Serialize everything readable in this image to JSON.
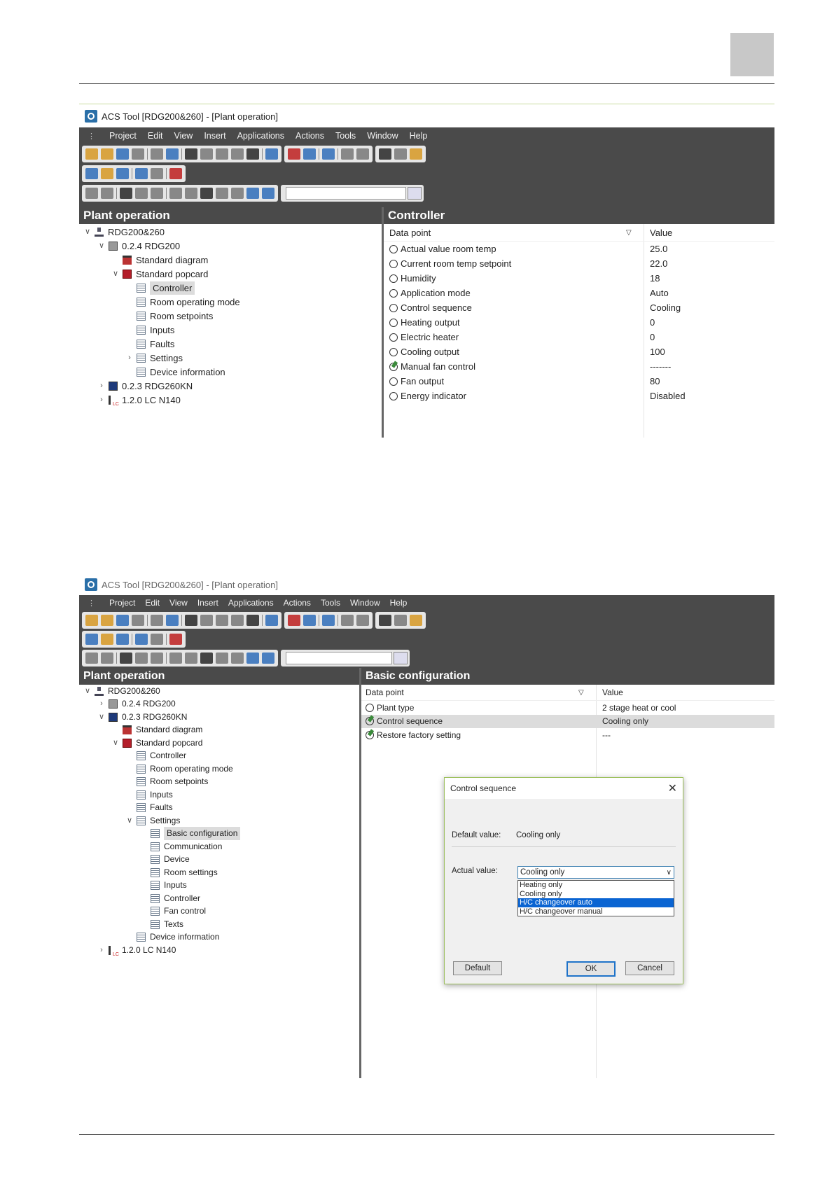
{
  "menu": [
    "Project",
    "Edit",
    "View",
    "Insert",
    "Applications",
    "Actions",
    "Tools",
    "Window",
    "Help"
  ],
  "shot1": {
    "title": "ACS Tool [RDG200&260] - [Plant operation]",
    "left_header": "Plant operation",
    "right_header": "Controller",
    "tree": [
      "RDG200&260",
      "0.2.4 RDG200",
      "Standard diagram",
      "Standard popcard",
      "Controller",
      "Room operating mode",
      "Room setpoints",
      "Inputs",
      "Faults",
      "Settings",
      "Device information",
      "0.2.3  RDG260KN",
      "1.2.0  LC N140"
    ],
    "col_datapoint": "Data point",
    "col_value": "Value",
    "rows": [
      {
        "dp": "Actual value room temp",
        "v": "25.0"
      },
      {
        "dp": "Current room temp setpoint",
        "v": "22.0"
      },
      {
        "dp": "Humidity",
        "v": "18"
      },
      {
        "dp": "Application mode",
        "v": "Auto"
      },
      {
        "dp": "Control sequence",
        "v": "Cooling"
      },
      {
        "dp": "Heating output",
        "v": "0"
      },
      {
        "dp": "Electric heater",
        "v": "0"
      },
      {
        "dp": "Cooling output",
        "v": "100"
      },
      {
        "dp": "Manual fan control",
        "v": "-------"
      },
      {
        "dp": "Fan output",
        "v": "80"
      },
      {
        "dp": "Energy indicator",
        "v": "Disabled"
      }
    ]
  },
  "shot2": {
    "title": "ACS Tool [RDG200&260] - [Plant operation]",
    "left_header": "Plant operation",
    "right_header": "Basic configuration",
    "tree": [
      "RDG200&260",
      "0.2.4 RDG200",
      "0.2.3  RDG260KN",
      "Standard diagram",
      "Standard popcard",
      "Controller",
      "Room operating mode",
      "Room setpoints",
      "Inputs",
      "Faults",
      "Settings",
      "Basic configuration",
      "Communication",
      "Device",
      "Room settings",
      "Inputs",
      "Controller",
      "Fan control",
      "Texts",
      "Device information",
      "1.2.0  LC N140"
    ],
    "col_datapoint": "Data point",
    "col_value": "Value",
    "rows": [
      {
        "dp": "Plant type",
        "v": "2 stage heat or cool"
      },
      {
        "dp": "Control sequence",
        "v": "Cooling only"
      },
      {
        "dp": "Restore factory setting",
        "v": "---"
      }
    ],
    "dialog": {
      "title": "Control sequence",
      "default_label": "Default value:",
      "default_value": "Cooling only",
      "actual_label": "Actual value:",
      "actual_value": "Cooling only",
      "options": [
        "Heating only",
        "Cooling only",
        "H/C changeover auto",
        "H/C changeover manual"
      ],
      "highlighted_option": "H/C changeover auto",
      "btn_default": "Default",
      "btn_ok": "OK",
      "btn_cancel": "Cancel"
    }
  }
}
